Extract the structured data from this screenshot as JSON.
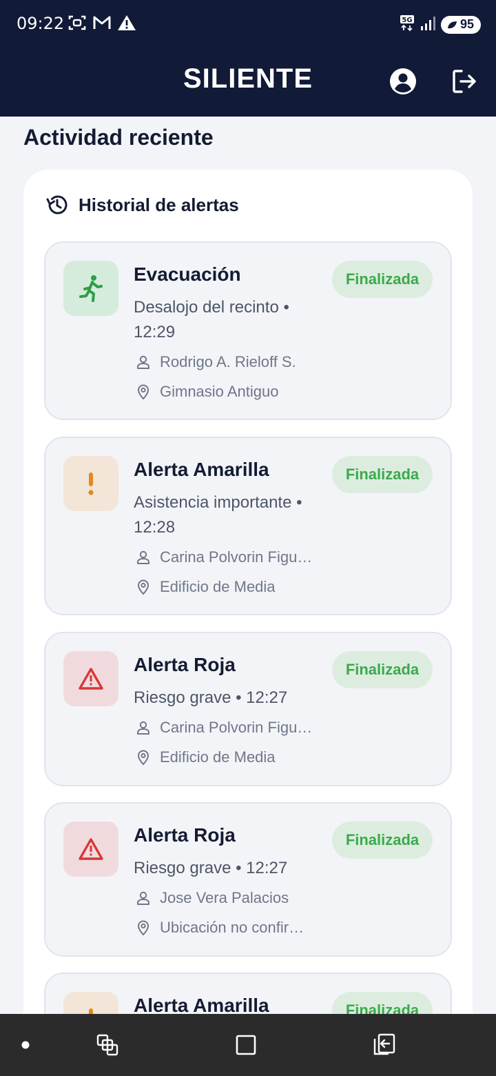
{
  "status_bar": {
    "time": "09:22",
    "battery": "95",
    "icons": [
      "screenshot-icon",
      "gmail-icon",
      "warning-icon",
      "5g-icon",
      "signal-icon"
    ]
  },
  "app_bar": {
    "title": "SILIENTE",
    "icons": [
      "account-circle-icon",
      "logout-icon"
    ]
  },
  "section_title": "Actividad reciente",
  "history": {
    "title": "Historial de alertas",
    "icon": "history-icon",
    "cards": [
      {
        "title": "Evacuación",
        "subtitle": "Desalojo del recinto • 12:29",
        "person": "Rodrigo A. Rieloff S.",
        "location": "Gimnasio Antiguo",
        "status": "Finalizada",
        "icon": "running-person-icon"
      },
      {
        "title": "Alerta Amarilla",
        "subtitle": "Asistencia importante • 12:28",
        "person": "Carina Polvorin Figu…",
        "location": "Edificio de Media",
        "status": "Finalizada",
        "icon": "exclamation-icon"
      },
      {
        "title": "Alerta Roja",
        "subtitle": "Riesgo grave • 12:27",
        "person": "Carina Polvorin Figu…",
        "location": "Edificio de Media",
        "status": "Finalizada",
        "icon": "warning-triangle-icon"
      },
      {
        "title": "Alerta Roja",
        "subtitle": "Riesgo grave • 12:27",
        "person": "Jose Vera Palacios",
        "location": "Ubicación no confir…",
        "status": "Finalizada",
        "icon": "warning-triangle-icon"
      },
      {
        "title": "Alerta Amarilla",
        "status": "Finalizada",
        "icon": "exclamation-icon"
      }
    ]
  },
  "colors": {
    "header_bg": "#111a37",
    "evacuation_green": "#2e9e46",
    "yellow_alert": "#e08a1e",
    "red_alert": "#d93636",
    "status_green": "#3aaa4b"
  },
  "nav_bar": {
    "icons": [
      "dot-icon",
      "recent-apps-icon",
      "home-square-icon",
      "back-icon"
    ]
  }
}
